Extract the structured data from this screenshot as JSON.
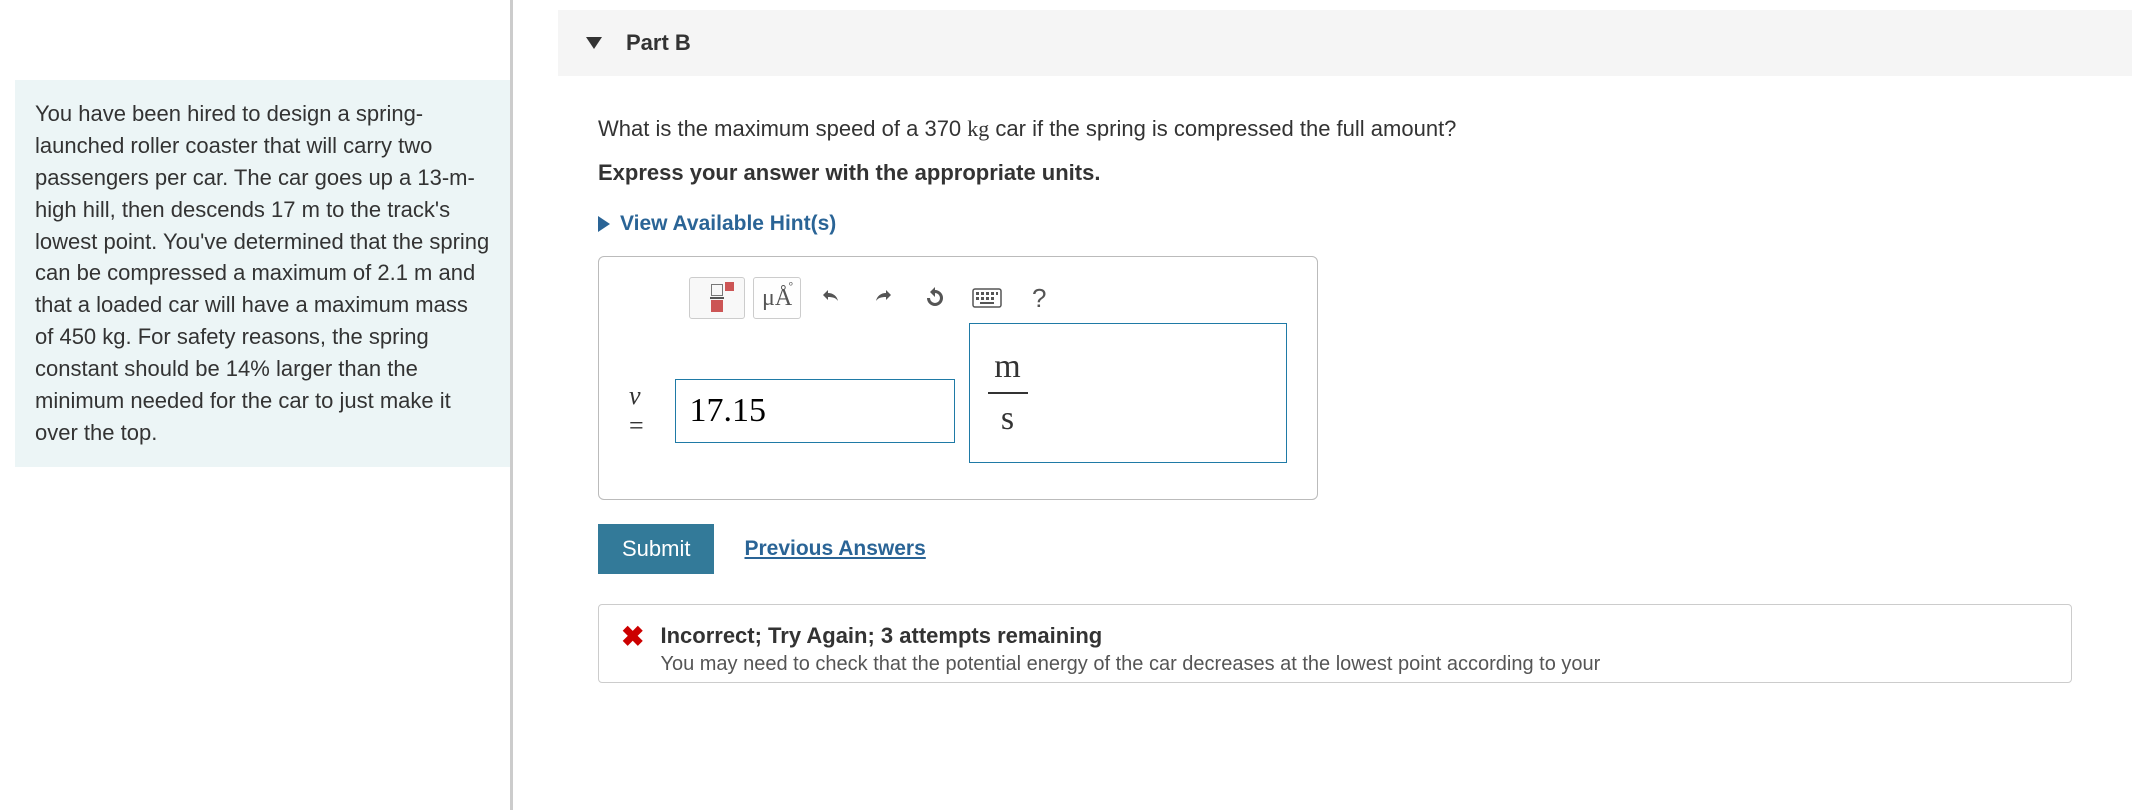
{
  "problem": {
    "text": "You have been hired to design a spring-launched roller coaster that will carry two passengers per car. The car goes up a 13-m-high hill, then descends 17 m to the track's lowest point. You've determined that the spring can be compressed a maximum of 2.1 m and that a loaded car will have a maximum mass of 450 kg. For safety reasons, the spring constant should be 14% larger than the minimum needed for the car to just make it over the top."
  },
  "part": {
    "label": "Part B",
    "question_pre": "What is the maximum speed of a 370 ",
    "question_unit": "kg",
    "question_post": " car if the spring is compressed the full amount?",
    "instruction": "Express your answer with the appropriate units.",
    "hints_label": "View Available Hint(s)"
  },
  "toolbar": {
    "templates_title": "templates",
    "symbols_label": "μÅ",
    "undo_title": "undo",
    "redo_title": "redo",
    "reset_title": "reset",
    "keyboard_title": "keyboard",
    "help_label": "?"
  },
  "answer": {
    "var": "v",
    "eq": " = ",
    "value": "17.15",
    "unit_num": "m",
    "unit_den": "s"
  },
  "actions": {
    "submit": "Submit",
    "previous": "Previous Answers"
  },
  "feedback": {
    "title": "Incorrect; Try Again; 3 attempts remaining",
    "sub": "You may need to check that the potential energy of the car decreases at the lowest point according to your"
  }
}
